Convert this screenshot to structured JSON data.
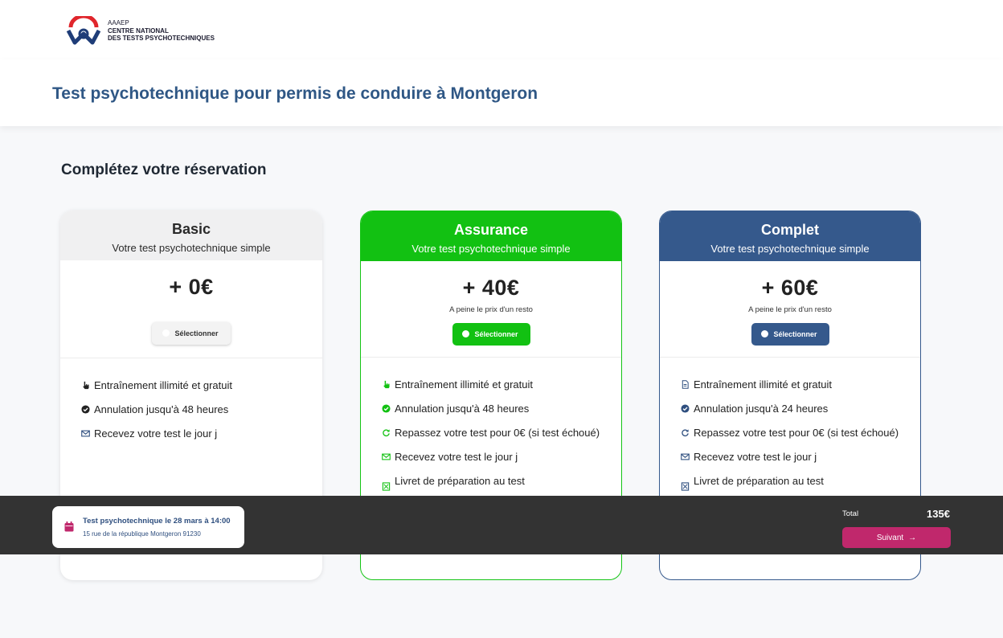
{
  "header": {
    "logo_line1": "AAAEP",
    "logo_line2": "CENTRE NATIONAL",
    "logo_line3": "DES TESTS PSYCHOTECHNIQUES"
  },
  "page_title": "Test psychotechnique pour permis de conduire à Montgeron",
  "section_title": "Complétez votre réservation",
  "plans": [
    {
      "name": "Basic",
      "subtitle": "Votre test psychotechnique simple",
      "price": "+ 0€",
      "note": "",
      "select_label": "Sélectionner",
      "features": [
        {
          "icon": "hand-pointer-icon",
          "label": "Entraînement illimité et gratuit"
        },
        {
          "icon": "check-circle-icon",
          "label": "Annulation jusqu'à 48 heures"
        },
        {
          "icon": "envelope-icon",
          "label": "Recevez votre test le jour j"
        }
      ]
    },
    {
      "name": "Assurance",
      "subtitle": "Votre test psychotechnique simple",
      "price": "+ 40€",
      "note": "A peine le prix d'un resto",
      "select_label": "Sélectionner",
      "features": [
        {
          "icon": "hand-pointer-icon",
          "label": "Entraînement illimité et gratuit"
        },
        {
          "icon": "check-circle-icon",
          "label": "Annulation jusqu'à 48 heures"
        },
        {
          "icon": "redo-icon",
          "label": "Repassez votre test pour 0€ (si test échoué)"
        },
        {
          "icon": "envelope-icon",
          "label": "Recevez votre test le jour j"
        },
        {
          "icon": "book-icon",
          "label": "Livret de préparation au test"
        }
      ]
    },
    {
      "name": "Complet",
      "subtitle": "Votre test psychotechnique simple",
      "price": "+ 60€",
      "note": "A peine le prix d'un resto",
      "select_label": "Sélectionner",
      "features": [
        {
          "icon": "document-icon",
          "label": "Entraînement illimité et gratuit"
        },
        {
          "icon": "check-circle-icon",
          "label": "Annulation jusqu'à 24 heures"
        },
        {
          "icon": "redo-icon",
          "label": "Repassez votre test pour 0€ (si test échoué)"
        },
        {
          "icon": "envelope-icon",
          "label": "Recevez votre test le jour j"
        },
        {
          "icon": "book-icon",
          "label": "Livret de préparation au test"
        }
      ]
    }
  ],
  "footer": {
    "booking_title": "Test psychotechnique le 28 mars à 14:00",
    "booking_address": "15 rue de la république Montgeron 91230",
    "total_label": "Total",
    "total_value": "135€",
    "next_label": "Suivant"
  },
  "colors": {
    "brand_blue": "#35598c",
    "green": "#12c112",
    "accent_pink": "#c0286c",
    "title_blue": "#2f5785",
    "footer_bg": "#333333"
  }
}
